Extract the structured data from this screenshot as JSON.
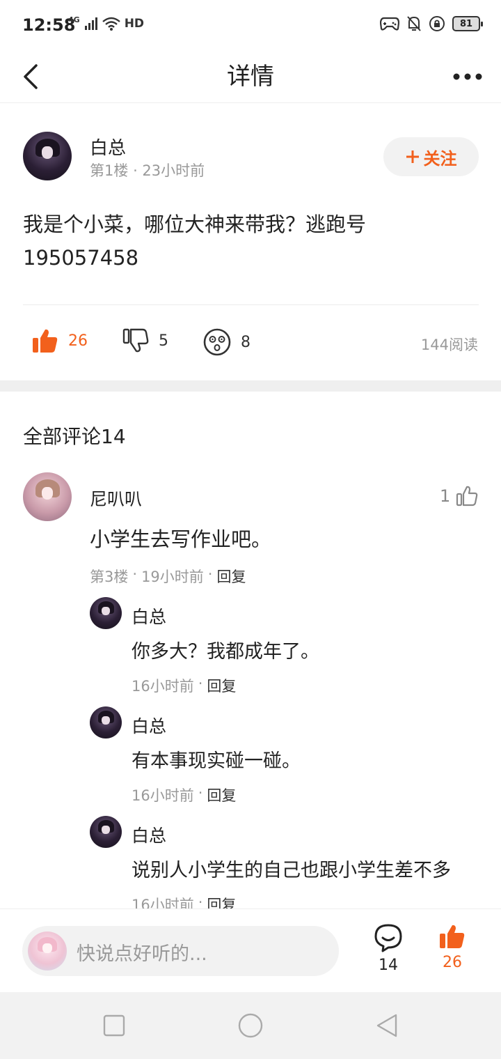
{
  "status_bar": {
    "time": "12:58",
    "network": "4G",
    "hd": "HD",
    "battery": "81"
  },
  "nav": {
    "title": "详情"
  },
  "post": {
    "author": "白总",
    "floor": "第1楼",
    "time": "23小时前",
    "follow_label": "关注",
    "body_line1": "我是个小菜，哪位大神来带我？逃跑号",
    "body_line2": "195057458",
    "likes": "26",
    "dislikes": "5",
    "reactions": "8",
    "reads": "144阅读"
  },
  "comments": {
    "title": "全部评论14",
    "main": {
      "author": "尼叭叭",
      "text": "小学生去写作业吧。",
      "floor": "第3楼",
      "time": "19小时前",
      "reply_label": "回复",
      "likes": "1"
    },
    "replies": [
      {
        "author": "白总",
        "text": "你多大？我都成年了。",
        "time": "16小时前",
        "reply_label": "回复"
      },
      {
        "author": "白总",
        "text": "有本事现实碰一碰。",
        "time": "16小时前",
        "reply_label": "回复"
      },
      {
        "author": "白总",
        "text": "说别人小学生的自己也跟小学生差不多",
        "time": "16小时前",
        "reply_label": "回复"
      }
    ]
  },
  "bottom_bar": {
    "placeholder": "快说点好听的...",
    "comment_count": "14",
    "like_count": "26"
  },
  "colors": {
    "accent": "#f2601c",
    "muted_text": "#999999"
  }
}
